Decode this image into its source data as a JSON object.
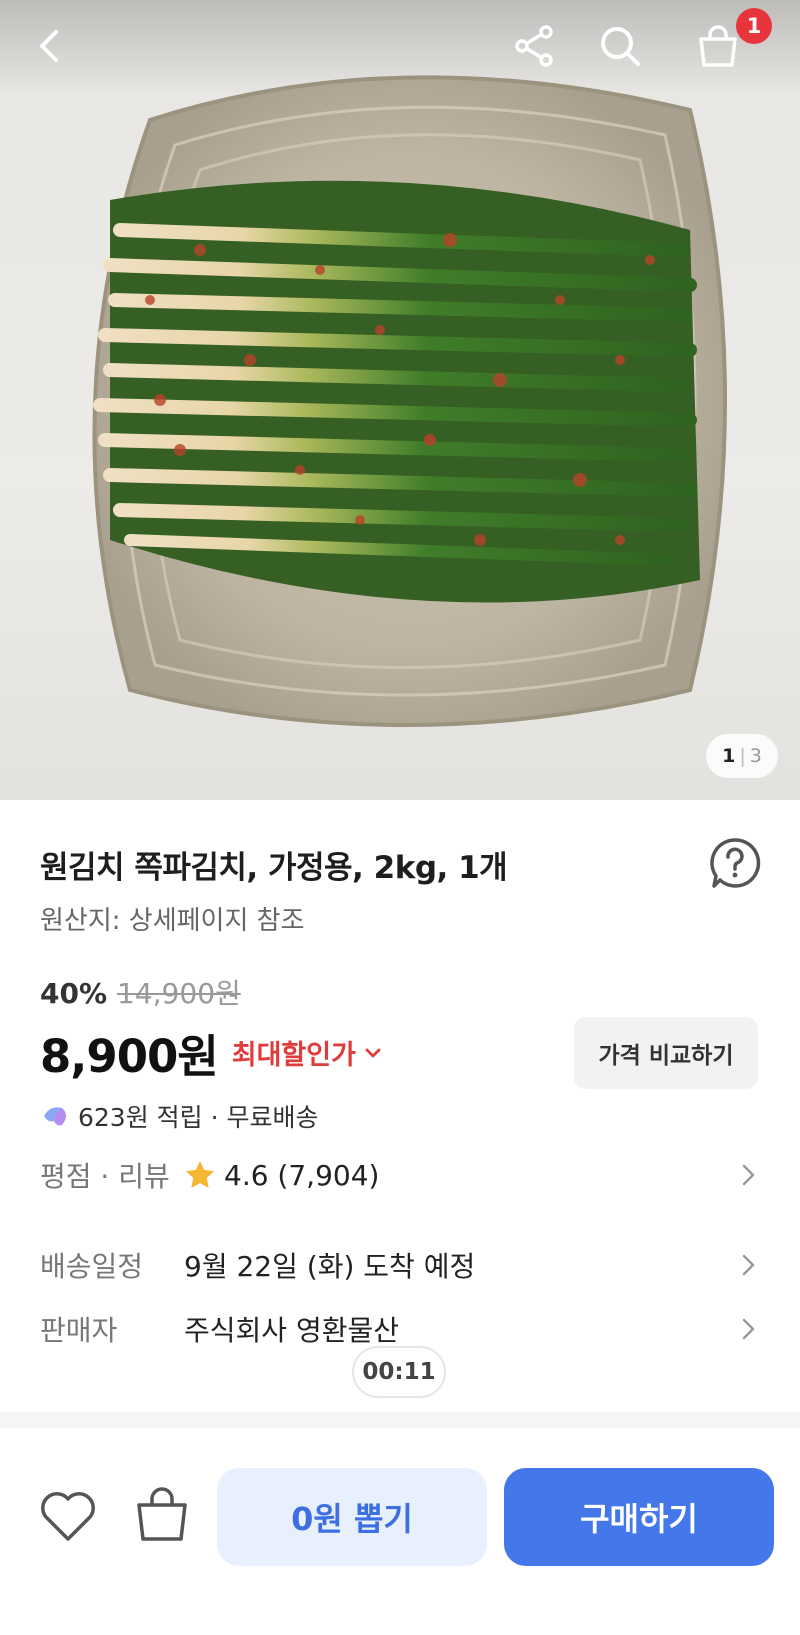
{
  "header": {
    "back_icon": "chevron-left-icon",
    "share_icon": "share-icon",
    "search_icon": "search-icon",
    "cart_icon": "shopping-bag-icon",
    "cart_count": "1"
  },
  "gallery": {
    "current": "1",
    "separator": "|",
    "total": "3"
  },
  "product": {
    "title": "원김치 쪽파김치, 가정용, 2kg, 1개",
    "origin": "원산지: 상세페이지 참조",
    "discount_rate": "40%",
    "original_price": "14,900원",
    "price": "8,900원",
    "max_discount_label": "최대할인가",
    "compare_label": "가격 비교하기",
    "reward_text": "623원 적립 · 무료배송"
  },
  "info": {
    "rating_label": "평점 · 리뷰",
    "rating_value": "4.6 (7,904)",
    "delivery_label": "배송일정",
    "delivery_value": "9월 22일 (화) 도착 예정",
    "seller_label": "판매자",
    "seller_value": "주식회사 영환물산"
  },
  "timer": "00:11",
  "bottom": {
    "wish_icon": "heart-icon",
    "cart_icon": "shopping-bag-icon",
    "pick_label": "0원 뽑기",
    "buy_label": "구매하기"
  },
  "colors": {
    "accent": "#4477ea",
    "discount_red": "#e03c3c",
    "badge_red": "#e8353d",
    "star": "#f5b731"
  }
}
